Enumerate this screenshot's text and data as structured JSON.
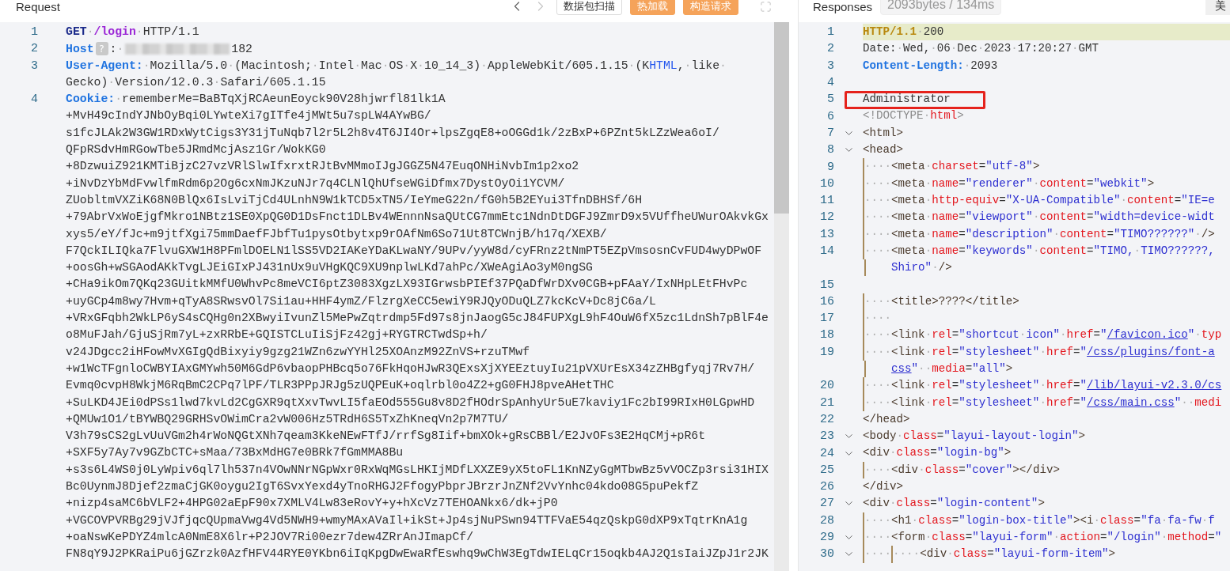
{
  "request": {
    "title": "Request",
    "nav": [
      {
        "kind": "back",
        "disabled": false
      },
      {
        "kind": "forward",
        "disabled": true
      }
    ],
    "buttons": [
      {
        "label": "数据包扫描",
        "kind": "outline"
      },
      {
        "label": "热加载",
        "kind": "primary"
      },
      {
        "label": "构造请求",
        "kind": "primary"
      }
    ],
    "lines": [
      {
        "number": "1",
        "rows": [
          {
            "tokens": [
              {
                "kind": "method",
                "text": "GET"
              },
              {
                "kind": "plain",
                "text": "·"
              },
              {
                "kind": "path",
                "text": "/login"
              },
              {
                "kind": "plain",
                "text": "·HTTP/1.1"
              }
            ]
          }
        ]
      },
      {
        "number": "2",
        "rows": [
          {
            "tokens": [
              {
                "kind": "key",
                "text": "Host"
              },
              {
                "kind": "help",
                "text": "?"
              },
              {
                "kind": "plain",
                "text": ":·"
              },
              {
                "kind": "redacted"
              },
              {
                "kind": "plain",
                "text": "182"
              }
            ]
          }
        ]
      },
      {
        "number": "3",
        "rows": [
          {
            "tokens": [
              {
                "kind": "key",
                "text": "User-Agent:"
              },
              {
                "kind": "plain",
                "text": "·Mozilla/5.0·(Macintosh;·Intel·Mac·OS·X·10_14_3)·AppleWebKit/605.1.15·(K"
              },
              {
                "kind": "ident",
                "text": "HTML"
              },
              {
                "kind": "plain",
                "text": ",·like·"
              }
            ]
          },
          {
            "tokens": [
              {
                "kind": "plain",
                "text": "Gecko)·Version/12.0.3·Safari/605.1.15"
              }
            ]
          }
        ]
      },
      {
        "number": "4",
        "rows": [
          {
            "tokens": [
              {
                "kind": "key",
                "text": "Cookie:"
              },
              {
                "kind": "plain",
                "text": "·rememberMe=BaBTqXjRCAeunEoyck90V28hjwrfl81lk1A"
              }
            ]
          },
          {
            "tokens": [
              {
                "kind": "plain",
                "text": "+MvH49cIndYJNbOyBqi0LYwteXi7gITfe4jMWt5u7spLW4AYwBG/"
              }
            ]
          },
          {
            "tokens": [
              {
                "kind": "plain",
                "text": "s1fcJLAk2W3GW1RDxWytCigs3Y31jTuNqb7l2r5L2h8v4T6JI4Or+lpsZgqE8+oOGGd1k/2zBxP+6PZnt5kLZzWea6oI/"
              }
            ]
          },
          {
            "tokens": [
              {
                "kind": "plain",
                "text": "QFpRSdvHmRGowTbe5JRmdMcjAsz1Gr/WokKG0"
              }
            ]
          },
          {
            "tokens": [
              {
                "kind": "plain",
                "text": "+8DzwuiZ921KMTiBjzC27vzVRlSlwIfxrxtRJtBvMMmoIJgJGGZ5N47EuqONHiNvbIm1p2xo2"
              }
            ]
          },
          {
            "tokens": [
              {
                "kind": "plain",
                "text": "+iNvDzYbMdFvwlfmRdm6p2Og6cxNmJKzuNJr7q4CLNlQhUfseWGiDfmx7DystOyOi1YCVM/"
              }
            ]
          },
          {
            "tokens": [
              {
                "kind": "plain",
                "text": "ZUobltmVXZiK68N0BlQx6IsLviTjCd4ULnhN9W1kTCD5xTN5/IeYmeG22n/fG0h5B2EYui3TfnDBHSf/6H"
              }
            ]
          },
          {
            "tokens": [
              {
                "kind": "plain",
                "text": "+79AbrVxWoEjgfMkro1NBtz1SE0XpQG0D1DsFnct1DLBv4WEnnnNsaQUtCG7mmEtc1NdnDtDGFJ9ZmrD9x5VUffheUWurOAkvkGx"
              }
            ]
          },
          {
            "tokens": [
              {
                "kind": "plain",
                "text": "xys5/eY/fJc+m9jtfXgi75mmDaefFJbfTu1pysOtbytxp9rOAfNm6So71Ut8TCWnjB/h17q/XEXB/"
              }
            ]
          },
          {
            "tokens": [
              {
                "kind": "plain",
                "text": "F7QckILIQka7FlvuGXW1H8PFmlDOELN1lSS5VD2IAKeYDaKLwaNY/9UPv/yyW8d/cyFRnz2tNmPT5EZpVmsosnCvFUD4wyDPwOF"
              }
            ]
          },
          {
            "tokens": [
              {
                "kind": "plain",
                "text": "+oosGh+wSGAodAKkTvgLJEiGIxPJ431nUx9uVHgKQC9XU9nplwLKd7ahPc/XWeAgiAo3yM0ngSG"
              }
            ]
          },
          {
            "tokens": [
              {
                "kind": "plain",
                "text": "+CHa9ikOm7QKq23GUitkMMfU0WhvPc8meVCI6ptZ3083XgzLX93IGrwsbPIEf37PQaDfWrDXv0CGB+pFAaY/IxNHpLEtFHvPc"
              }
            ]
          },
          {
            "tokens": [
              {
                "kind": "plain",
                "text": "+uyGCp4m8wy7Hvm+qTyA8SRwsvOl7Si1au+HHF4ymZ/FlzrgXeCC5ewiY9RJQyODuQLZ7kcKcV+Dc8jC6a/L"
              }
            ]
          },
          {
            "tokens": [
              {
                "kind": "plain",
                "text": "+VRxGFqbh2WkLP6yS4sCQHg0n2XBwyiIvunZl5MePwZqtrdmp5Fd97s8jnJaogG5cJ84FUPXgL9hF4OuW6fX5zc1LdnSh7pBlF4e"
              }
            ]
          },
          {
            "tokens": [
              {
                "kind": "plain",
                "text": "o8MuFJah/GjuSjRm7yL+zxRRbE+GQISTCLuIiSjFz42gj+RYGTRCTwdSp+h/"
              }
            ]
          },
          {
            "tokens": [
              {
                "kind": "plain",
                "text": "v24JDgcc2iHFowMvXGIgQdBixyiy9gzg21WZn6zwYYHl25XOAnzM92ZnVS+rzuTMwf"
              }
            ]
          },
          {
            "tokens": [
              {
                "kind": "plain",
                "text": "+w1WcTFgnloCWBYIAxGMYwh50M6GdP6vbaopPHBcq5o76FkHqoHJwR3QExsXjXYEEztuyIu21pVXUrEsX34zZHBgfyqj7Rv7H/"
              }
            ]
          },
          {
            "tokens": [
              {
                "kind": "plain",
                "text": "Evmq0cvpH8WkjM6RqBmC2CPq7lPF/TLR3PPpJRJg5zUQPEuK+oqlrbl0o4Z2+gG0FHJ8pveAHetTHC"
              }
            ]
          },
          {
            "tokens": [
              {
                "kind": "plain",
                "text": "+SuLKD4JEi0dPSs1lwd7kvLd2CgGXR9qtXxvTwvLI5faEOd555Gu8v8D2fHOdrSpAnhyUr5uE7kaviy1Fc2bI99RIxH0LGpwHD"
              }
            ]
          },
          {
            "tokens": [
              {
                "kind": "plain",
                "text": "+QMUw1O1/tBYWBQ29GRHSvOWimCra2vW006Hz5TRdH6S5TxZhKneqVn2p7M7TU/"
              }
            ]
          },
          {
            "tokens": [
              {
                "kind": "plain",
                "text": "V3h79sCS2gLvUuVGm2h4rWoNQGtXNh7qeam3KkeNEwFTfJ/rrfSg8Iif+bmXOk+gRsCBBl/E2JvOFs3E2HqCMj+pR6t"
              }
            ]
          },
          {
            "tokens": [
              {
                "kind": "plain",
                "text": "+SXF5y7Ay7v9GZbCTC+sMaa/73BxMdHG7e0BRk7fGmMMA8Bu"
              }
            ]
          },
          {
            "tokens": [
              {
                "kind": "plain",
                "text": "+s3s6L4WS0j0LyWpiv6ql7lh537n4VOwNNrNGpWxr0RxWqMGsLHKIjMDfLXXZE9yX5toFL1KnNZyGgMTbwBz5vVOCZp3rsi31HIX"
              }
            ]
          },
          {
            "tokens": [
              {
                "kind": "plain",
                "text": "Bc0UynmJ8Djef2zmaCjGK0oygu2IgT6SvxYexd4yTnoRHGJ2FfogyPbprJBrzrJnZNf2VvYnhc04kdo08G5puPekfZ"
              }
            ]
          },
          {
            "tokens": [
              {
                "kind": "plain",
                "text": "+nizp4saMC6bVLF2+4HPG02aEpF90x7XMLV4Lw83eRovY+y+hXcVz7TEHOANkx6/dk+jP0"
              }
            ]
          },
          {
            "tokens": [
              {
                "kind": "plain",
                "text": "+VGCOVPVRBg29jVJfjqcQUpmaVwg4Vd5NWH9+wmyMAxAVaIl+ikSt+Jp4sjNuPSwn94TTFVaE54qzQskpG0dXP9xTqtrKnA1g"
              }
            ]
          },
          {
            "tokens": [
              {
                "kind": "plain",
                "text": "+oaNswKePDYZ4mlcA0NmE8X6lr+P2JOV7Ri00ezr7dew4ZRrAnJImapCf/"
              }
            ]
          },
          {
            "tokens": [
              {
                "kind": "plain",
                "text": "FN8qY9J2PKRaiPu6jGZrzk0AzfHFV44RYE0YKbn6iIqKpgDwEwaRfEswhq9wChW3EgTdwIELqCr15oqkb4AJ2Q1sIaiJZpJ1r2JK"
              }
            ]
          }
        ]
      }
    ]
  },
  "response": {
    "title": "Responses",
    "stats": "2093bytes / 134ms",
    "buttons": [
      {
        "label": "美"
      }
    ],
    "lines": [
      {
        "number": "1",
        "highlighted": true,
        "rows": [
          {
            "tokens": [
              {
                "kind": "status",
                "text": "HTTP/1.1"
              },
              {
                "kind": "plain",
                "text": "·200"
              }
            ]
          }
        ]
      },
      {
        "number": "2",
        "rows": [
          {
            "tokens": [
              {
                "kind": "plain",
                "text": "Date:·Wed,·06·Dec·2023·17:20:27·GMT"
              }
            ]
          }
        ]
      },
      {
        "number": "3",
        "rows": [
          {
            "tokens": [
              {
                "kind": "key",
                "text": "Content-Length:"
              },
              {
                "kind": "plain",
                "text": "·2093"
              }
            ]
          }
        ]
      },
      {
        "number": "4"
      },
      {
        "number": "5",
        "boxed": true,
        "rows": [
          {
            "tokens": [
              {
                "kind": "plain",
                "text": "Administrator"
              }
            ]
          }
        ]
      },
      {
        "number": "6",
        "rows": [
          {
            "tokens": [
              {
                "kind": "doctype",
                "text": "<!DOCTYPE·"
              },
              {
                "kind": "attr",
                "text": "html"
              },
              {
                "kind": "doctype",
                "text": ">"
              }
            ]
          }
        ]
      },
      {
        "number": "7",
        "expanded": true,
        "rows": [
          {
            "tokens": [
              {
                "kind": "tag",
                "text": "<html>"
              }
            ]
          }
        ]
      },
      {
        "number": "8",
        "expanded": true,
        "rows": [
          {
            "tokens": [
              {
                "kind": "tag",
                "text": "<head>"
              }
            ]
          }
        ]
      },
      {
        "number": "9",
        "rows": [
          {
            "tokens": [
              {
                "kind": "indent",
                "text": "····"
              },
              {
                "kind": "tag",
                "text": "<meta"
              },
              {
                "kind": "plain",
                "text": "·"
              },
              {
                "kind": "attr",
                "text": "charset"
              },
              {
                "kind": "plain",
                "text": "="
              },
              {
                "kind": "string",
                "text": "\"utf-8\""
              },
              {
                "kind": "tag",
                "text": ">"
              }
            ]
          }
        ]
      },
      {
        "number": "10",
        "rows": [
          {
            "tokens": [
              {
                "kind": "indent",
                "text": "····"
              },
              {
                "kind": "tag",
                "text": "<meta"
              },
              {
                "kind": "plain",
                "text": "·"
              },
              {
                "kind": "attr",
                "text": "name"
              },
              {
                "kind": "plain",
                "text": "="
              },
              {
                "kind": "string",
                "text": "\"renderer\""
              },
              {
                "kind": "plain",
                "text": "·"
              },
              {
                "kind": "attr",
                "text": "content"
              },
              {
                "kind": "plain",
                "text": "="
              },
              {
                "kind": "string",
                "text": "\"webkit\""
              },
              {
                "kind": "tag",
                "text": ">"
              }
            ]
          }
        ]
      },
      {
        "number": "11",
        "rows": [
          {
            "tokens": [
              {
                "kind": "indent",
                "text": "····"
              },
              {
                "kind": "tag",
                "text": "<meta"
              },
              {
                "kind": "plain",
                "text": "·"
              },
              {
                "kind": "attr",
                "text": "http-equiv"
              },
              {
                "kind": "plain",
                "text": "="
              },
              {
                "kind": "string",
                "text": "\"X-UA-Compatible\""
              },
              {
                "kind": "plain",
                "text": "·"
              },
              {
                "kind": "attr",
                "text": "content"
              },
              {
                "kind": "plain",
                "text": "="
              },
              {
                "kind": "string",
                "text": "\"IE=e"
              }
            ]
          }
        ]
      },
      {
        "number": "12",
        "rows": [
          {
            "tokens": [
              {
                "kind": "indent",
                "text": "····"
              },
              {
                "kind": "tag",
                "text": "<meta"
              },
              {
                "kind": "plain",
                "text": "·"
              },
              {
                "kind": "attr",
                "text": "name"
              },
              {
                "kind": "plain",
                "text": "="
              },
              {
                "kind": "string",
                "text": "\"viewport\""
              },
              {
                "kind": "plain",
                "text": "·"
              },
              {
                "kind": "attr",
                "text": "content"
              },
              {
                "kind": "plain",
                "text": "="
              },
              {
                "kind": "string",
                "text": "\"width=device-widt"
              }
            ]
          }
        ]
      },
      {
        "number": "13",
        "rows": [
          {
            "tokens": [
              {
                "kind": "indent",
                "text": "····"
              },
              {
                "kind": "tag",
                "text": "<meta"
              },
              {
                "kind": "plain",
                "text": "·"
              },
              {
                "kind": "attr",
                "text": "name"
              },
              {
                "kind": "plain",
                "text": "="
              },
              {
                "kind": "string",
                "text": "\"description\""
              },
              {
                "kind": "plain",
                "text": "·"
              },
              {
                "kind": "attr",
                "text": "content"
              },
              {
                "kind": "plain",
                "text": "="
              },
              {
                "kind": "string",
                "text": "\"TIMO??????\""
              },
              {
                "kind": "tag",
                "text": "·/>"
              }
            ]
          }
        ]
      },
      {
        "number": "14",
        "rows": [
          {
            "tokens": [
              {
                "kind": "indent",
                "text": "····"
              },
              {
                "kind": "tag",
                "text": "<meta"
              },
              {
                "kind": "plain",
                "text": "·"
              },
              {
                "kind": "attr",
                "text": "name"
              },
              {
                "kind": "plain",
                "text": "="
              },
              {
                "kind": "string",
                "text": "\"keywords\""
              },
              {
                "kind": "plain",
                "text": "·"
              },
              {
                "kind": "attr",
                "text": "content"
              },
              {
                "kind": "plain",
                "text": "="
              },
              {
                "kind": "string",
                "text": "\"TIMO,·TIMO??????,"
              }
            ]
          },
          {
            "tokens": [
              {
                "kind": "string",
                "text": "Shiro\""
              },
              {
                "kind": "tag",
                "text": "·/>"
              }
            ]
          }
        ]
      },
      {
        "number": "15"
      },
      {
        "number": "16",
        "rows": [
          {
            "tokens": [
              {
                "kind": "indent",
                "text": "····"
              },
              {
                "kind": "tag",
                "text": "<title>????</title>"
              }
            ]
          }
        ]
      },
      {
        "number": "17",
        "rows": [
          {
            "tokens": [
              {
                "kind": "indent",
                "text": "····"
              }
            ]
          }
        ]
      },
      {
        "number": "18",
        "rows": [
          {
            "tokens": [
              {
                "kind": "indent",
                "text": "····"
              },
              {
                "kind": "tag",
                "text": "<link"
              },
              {
                "kind": "plain",
                "text": "·"
              },
              {
                "kind": "attr",
                "text": "rel"
              },
              {
                "kind": "plain",
                "text": "="
              },
              {
                "kind": "string",
                "text": "\"shortcut·icon\""
              },
              {
                "kind": "plain",
                "text": "·"
              },
              {
                "kind": "attr",
                "text": "href"
              },
              {
                "kind": "plain",
                "text": "="
              },
              {
                "kind": "string",
                "text": "\""
              },
              {
                "kind": "link",
                "text": "/favicon.ico"
              },
              {
                "kind": "string",
                "text": "\""
              },
              {
                "kind": "plain",
                "text": "·"
              },
              {
                "kind": "attr",
                "text": "typ"
              }
            ]
          }
        ]
      },
      {
        "number": "19",
        "rows": [
          {
            "tokens": [
              {
                "kind": "indent",
                "text": "····"
              },
              {
                "kind": "tag",
                "text": "<link"
              },
              {
                "kind": "plain",
                "text": "·"
              },
              {
                "kind": "attr",
                "text": "rel"
              },
              {
                "kind": "plain",
                "text": "="
              },
              {
                "kind": "string",
                "text": "\"stylesheet\""
              },
              {
                "kind": "plain",
                "text": "·"
              },
              {
                "kind": "attr",
                "text": "href"
              },
              {
                "kind": "plain",
                "text": "="
              },
              {
                "kind": "string",
                "text": "\""
              },
              {
                "kind": "link",
                "text": "/css/plugins/font-a"
              }
            ]
          },
          {
            "tokens": [
              {
                "kind": "link",
                "text": "css"
              },
              {
                "kind": "string",
                "text": "\""
              },
              {
                "kind": "plain",
                "text": "··"
              },
              {
                "kind": "attr",
                "text": "media"
              },
              {
                "kind": "plain",
                "text": "="
              },
              {
                "kind": "string",
                "text": "\"all\""
              },
              {
                "kind": "tag",
                "text": ">"
              }
            ]
          }
        ]
      },
      {
        "number": "20",
        "rows": [
          {
            "tokens": [
              {
                "kind": "indent",
                "text": "····"
              },
              {
                "kind": "tag",
                "text": "<link"
              },
              {
                "kind": "plain",
                "text": "·"
              },
              {
                "kind": "attr",
                "text": "rel"
              },
              {
                "kind": "plain",
                "text": "="
              },
              {
                "kind": "string",
                "text": "\"stylesheet\""
              },
              {
                "kind": "plain",
                "text": "·"
              },
              {
                "kind": "attr",
                "text": "href"
              },
              {
                "kind": "plain",
                "text": "="
              },
              {
                "kind": "string",
                "text": "\""
              },
              {
                "kind": "link",
                "text": "/lib/layui-v2.3.0/cs"
              }
            ]
          }
        ]
      },
      {
        "number": "21",
        "rows": [
          {
            "tokens": [
              {
                "kind": "indent",
                "text": "····"
              },
              {
                "kind": "tag",
                "text": "<link"
              },
              {
                "kind": "plain",
                "text": "·"
              },
              {
                "kind": "attr",
                "text": "rel"
              },
              {
                "kind": "plain",
                "text": "="
              },
              {
                "kind": "string",
                "text": "\"stylesheet\""
              },
              {
                "kind": "plain",
                "text": "·"
              },
              {
                "kind": "attr",
                "text": "href"
              },
              {
                "kind": "plain",
                "text": "="
              },
              {
                "kind": "string",
                "text": "\""
              },
              {
                "kind": "link",
                "text": "/css/main.css"
              },
              {
                "kind": "string",
                "text": "\""
              },
              {
                "kind": "plain",
                "text": "··"
              },
              {
                "kind": "attr",
                "text": "medi"
              }
            ]
          }
        ]
      },
      {
        "number": "22",
        "rows": [
          {
            "tokens": [
              {
                "kind": "tag",
                "text": "</head>"
              }
            ]
          }
        ]
      },
      {
        "number": "23",
        "expanded": true,
        "rows": [
          {
            "tokens": [
              {
                "kind": "tag",
                "text": "<body"
              },
              {
                "kind": "plain",
                "text": "·"
              },
              {
                "kind": "attr",
                "text": "class"
              },
              {
                "kind": "plain",
                "text": "="
              },
              {
                "kind": "string",
                "text": "\"layui-layout-login\""
              },
              {
                "kind": "tag",
                "text": ">"
              }
            ]
          }
        ]
      },
      {
        "number": "24",
        "expanded": true,
        "rows": [
          {
            "tokens": [
              {
                "kind": "tag",
                "text": "<div"
              },
              {
                "kind": "plain",
                "text": "·"
              },
              {
                "kind": "attr",
                "text": "class"
              },
              {
                "kind": "plain",
                "text": "="
              },
              {
                "kind": "string",
                "text": "\"login-bg\""
              },
              {
                "kind": "tag",
                "text": ">"
              }
            ]
          }
        ]
      },
      {
        "number": "25",
        "rows": [
          {
            "tokens": [
              {
                "kind": "indent",
                "text": "····"
              },
              {
                "kind": "tag",
                "text": "<div"
              },
              {
                "kind": "plain",
                "text": "·"
              },
              {
                "kind": "attr",
                "text": "class"
              },
              {
                "kind": "plain",
                "text": "="
              },
              {
                "kind": "string",
                "text": "\"cover\""
              },
              {
                "kind": "tag",
                "text": "></div>"
              }
            ]
          }
        ]
      },
      {
        "number": "26",
        "rows": [
          {
            "tokens": [
              {
                "kind": "tag",
                "text": "</div>"
              }
            ]
          }
        ]
      },
      {
        "number": "27",
        "expanded": true,
        "rows": [
          {
            "tokens": [
              {
                "kind": "tag",
                "text": "<div"
              },
              {
                "kind": "plain",
                "text": "·"
              },
              {
                "kind": "attr",
                "text": "class"
              },
              {
                "kind": "plain",
                "text": "="
              },
              {
                "kind": "string",
                "text": "\"login-content\""
              },
              {
                "kind": "tag",
                "text": ">"
              }
            ]
          }
        ]
      },
      {
        "number": "28",
        "rows": [
          {
            "tokens": [
              {
                "kind": "indent",
                "text": "····"
              },
              {
                "kind": "tag",
                "text": "<h1"
              },
              {
                "kind": "plain",
                "text": "·"
              },
              {
                "kind": "attr",
                "text": "class"
              },
              {
                "kind": "plain",
                "text": "="
              },
              {
                "kind": "string",
                "text": "\"login-box-title\""
              },
              {
                "kind": "tag",
                "text": "><i"
              },
              {
                "kind": "plain",
                "text": "·"
              },
              {
                "kind": "attr",
                "text": "class"
              },
              {
                "kind": "plain",
                "text": "="
              },
              {
                "kind": "string",
                "text": "\"fa·fa-fw·f"
              }
            ]
          }
        ]
      },
      {
        "number": "29",
        "expanded": true,
        "rows": [
          {
            "tokens": [
              {
                "kind": "indent",
                "text": "····"
              },
              {
                "kind": "tag",
                "text": "<form"
              },
              {
                "kind": "plain",
                "text": "·"
              },
              {
                "kind": "attr",
                "text": "class"
              },
              {
                "kind": "plain",
                "text": "="
              },
              {
                "kind": "string",
                "text": "\"layui-form\""
              },
              {
                "kind": "plain",
                "text": "·"
              },
              {
                "kind": "attr",
                "text": "action"
              },
              {
                "kind": "plain",
                "text": "="
              },
              {
                "kind": "string",
                "text": "\"/login\""
              },
              {
                "kind": "plain",
                "text": "·"
              },
              {
                "kind": "attr",
                "text": "method"
              },
              {
                "kind": "plain",
                "text": "="
              },
              {
                "kind": "string",
                "text": "\""
              }
            ]
          }
        ]
      },
      {
        "number": "30",
        "expanded": true,
        "rows": [
          {
            "tokens": [
              {
                "kind": "indent",
                "text": "····"
              },
              {
                "kind": "indent",
                "text": "····"
              },
              {
                "kind": "tag",
                "text": "<div"
              },
              {
                "kind": "plain",
                "text": "·"
              },
              {
                "kind": "attr",
                "text": "class"
              },
              {
                "kind": "plain",
                "text": "="
              },
              {
                "kind": "string",
                "text": "\"layui-form-item\""
              },
              {
                "kind": "tag",
                "text": ">"
              }
            ]
          }
        ]
      }
    ]
  }
}
